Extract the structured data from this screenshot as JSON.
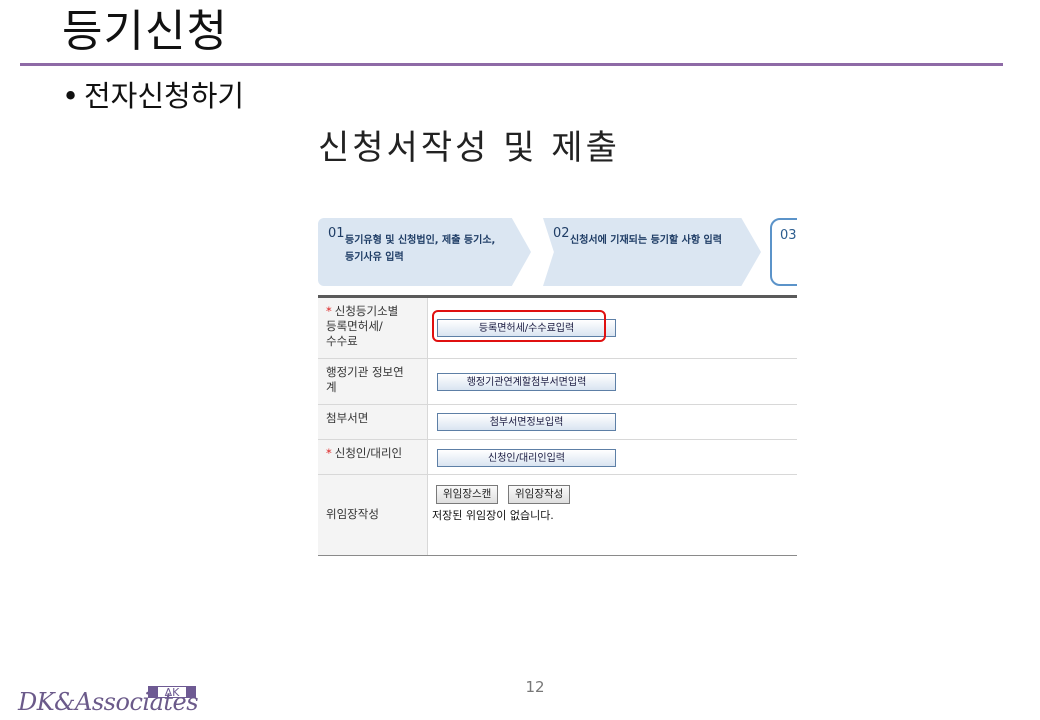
{
  "slide": {
    "title": "등기신청",
    "bullet": "전자신청하기",
    "subtitle": "신청서작성 및 제출",
    "page_number": "12"
  },
  "steps": [
    {
      "num": "01",
      "line1": "등기유형 및 신청법인, 제출 등기소,",
      "line2": "등기사유 입력"
    },
    {
      "num": "02",
      "line1": "신청서에 기재되는 등기할 사항 입력",
      "line2": ""
    },
    {
      "num": "03"
    }
  ],
  "form": {
    "rows": [
      {
        "required": true,
        "label_lines": [
          "신청등기소별",
          "등록면허세/",
          "수수료"
        ],
        "button": "등록면허세/수수료입력"
      },
      {
        "required": false,
        "label_lines": [
          "행정기관 정보연",
          "계"
        ],
        "button": "행정기관연계할첨부서면입력"
      },
      {
        "required": false,
        "label_lines": [
          "첨부서면"
        ],
        "button": "첨부서면정보입력"
      },
      {
        "required": true,
        "label_lines": [
          "신청인/대리인"
        ],
        "button": "신청인/대리인입력"
      },
      {
        "required": false,
        "label_lines": [
          "위임장작성"
        ],
        "buttons": [
          "위임장스캔",
          "위임장작성"
        ],
        "note": "저장된 위임장이 없습니다."
      }
    ],
    "required_mark": "*"
  },
  "logo": {
    "text": "DK&Associates",
    "mark": "ΔK"
  },
  "colors": {
    "rule": "#8e6aa6",
    "step_bg": "#dbe6f2",
    "highlight": "#e01010",
    "active_step_border": "#5b93c9"
  }
}
